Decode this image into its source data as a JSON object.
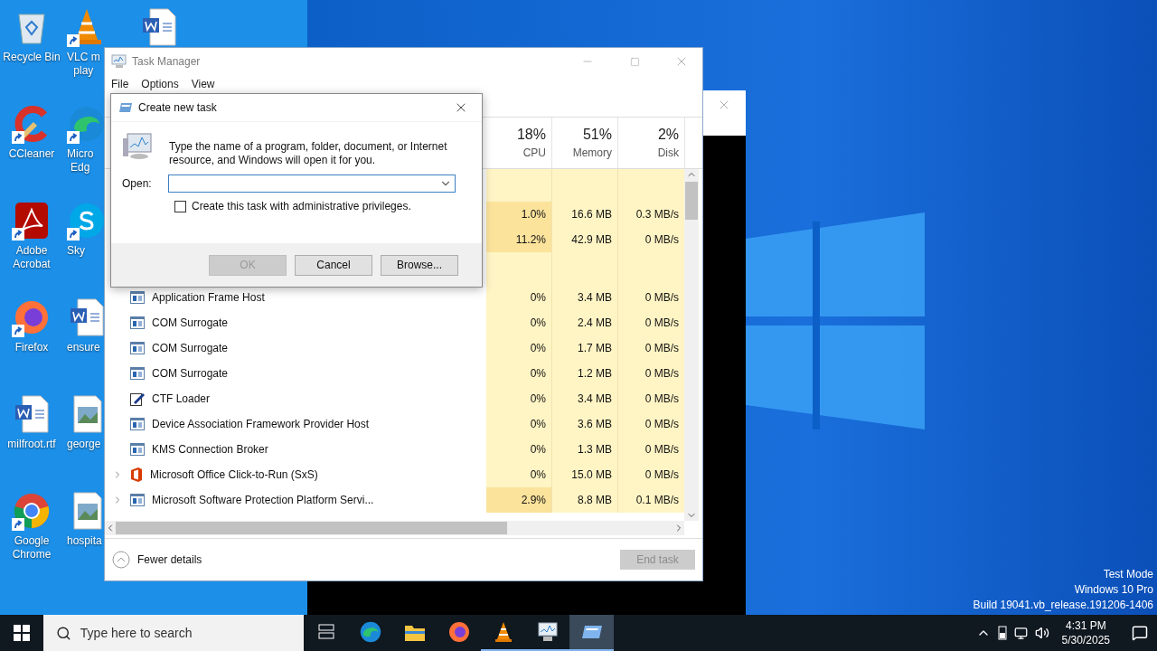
{
  "desktop_columns": [
    [
      {
        "kind": "recycle",
        "shortcut": false,
        "lines": [
          "Recycle Bin"
        ]
      },
      {
        "kind": "ccleaner",
        "shortcut": true,
        "lines": [
          "CCleaner"
        ]
      },
      {
        "kind": "acrobat",
        "shortcut": true,
        "lines": [
          "Adobe",
          "Acrobat"
        ]
      },
      {
        "kind": "firefox",
        "shortcut": true,
        "lines": [
          "Firefox"
        ]
      },
      {
        "kind": "word",
        "shortcut": false,
        "lines": [
          "milfroot.rtf"
        ]
      },
      {
        "kind": "chrome",
        "shortcut": true,
        "lines": [
          "Google",
          "Chrome"
        ]
      }
    ],
    [
      {
        "kind": "vlc",
        "shortcut": true,
        "lines": [
          "VLC m",
          "play"
        ]
      },
      {
        "kind": "edge",
        "shortcut": true,
        "lines": [
          "Micro",
          "Edg"
        ]
      },
      {
        "kind": "skype",
        "shortcut": true,
        "lines": [
          "Sky"
        ]
      },
      {
        "kind": "word",
        "shortcut": false,
        "lines": [
          "ensure"
        ]
      },
      {
        "kind": "image",
        "shortcut": false,
        "lines": [
          "george"
        ]
      },
      {
        "kind": "image",
        "shortcut": false,
        "lines": [
          "hospita"
        ]
      }
    ],
    [
      {
        "kind": "word",
        "shortcut": false
      }
    ]
  ],
  "task_manager": {
    "title": "Task Manager",
    "menu": [
      "File",
      "Options",
      "View"
    ],
    "columns": [
      {
        "percent": "18%",
        "label": "CPU"
      },
      {
        "percent": "51%",
        "label": "Memory"
      },
      {
        "percent": "2%",
        "label": "Disk"
      }
    ],
    "rows": [
      {
        "kind": "group"
      },
      {
        "kind": "covered",
        "cpu": "1.0%",
        "memory": "16.6 MB",
        "disk": "0.3 MB/s"
      },
      {
        "kind": "covered",
        "cpu": "11.2%",
        "memory": "42.9 MB",
        "disk": "0 MB/s"
      },
      {
        "kind": "group"
      },
      {
        "kind": "window",
        "expandable": false,
        "name": "Application Frame Host",
        "cpu": "0%",
        "memory": "3.4 MB",
        "disk": "0 MB/s"
      },
      {
        "kind": "window",
        "expandable": false,
        "name": "COM Surrogate",
        "cpu": "0%",
        "memory": "2.4 MB",
        "disk": "0 MB/s"
      },
      {
        "kind": "window",
        "expandable": false,
        "name": "COM Surrogate",
        "cpu": "0%",
        "memory": "1.7 MB",
        "disk": "0 MB/s"
      },
      {
        "kind": "window",
        "expandable": false,
        "name": "COM Surrogate",
        "cpu": "0%",
        "memory": "1.2 MB",
        "disk": "0 MB/s"
      },
      {
        "kind": "pen",
        "expandable": false,
        "name": "CTF Loader",
        "cpu": "0%",
        "memory": "3.4 MB",
        "disk": "0 MB/s"
      },
      {
        "kind": "window",
        "expandable": false,
        "name": "Device Association Framework Provider Host",
        "cpu": "0%",
        "memory": "3.6 MB",
        "disk": "0 MB/s"
      },
      {
        "kind": "window",
        "expandable": false,
        "name": "KMS Connection Broker",
        "cpu": "0%",
        "memory": "1.3 MB",
        "disk": "0 MB/s"
      },
      {
        "kind": "office",
        "expandable": true,
        "name": "Microsoft Office Click-to-Run (SxS)",
        "cpu": "0%",
        "memory": "15.0 MB",
        "disk": "0 MB/s"
      },
      {
        "kind": "window",
        "expandable": true,
        "name": "Microsoft Software Protection Platform Servi...",
        "cpu": "2.9%",
        "memory": "8.8 MB",
        "disk": "0.1 MB/s"
      }
    ],
    "fewer_details": "Fewer details",
    "end_task": {
      "label": "End task",
      "disabled": true
    }
  },
  "dialog": {
    "title": "Create new task",
    "message": "Type the name of a program, folder, document, or Internet resource, and Windows will open it for you.",
    "open_label": "Open:",
    "checkbox": {
      "label": "Create this task with administrative privileges.",
      "checked": false
    },
    "buttons": [
      {
        "label": "OK",
        "disabled": true
      },
      {
        "label": "Cancel",
        "disabled": false
      },
      {
        "label": "Browse...",
        "disabled": false
      }
    ]
  },
  "os_info": [
    "Test Mode",
    "Windows 10 Pro",
    "Build 19041.vb_release.191206-1406"
  ],
  "taskbar": {
    "search_placeholder": "Type here to search",
    "apps": [
      {
        "kind": "taskview",
        "running": false,
        "selected": false
      },
      {
        "kind": "edge",
        "running": false,
        "selected": false
      },
      {
        "kind": "explorer",
        "running": false,
        "selected": false
      },
      {
        "kind": "firefox",
        "running": false,
        "selected": false
      },
      {
        "kind": "vlc",
        "running": true,
        "selected": false
      },
      {
        "kind": "taskmgr",
        "running": true,
        "selected": false
      },
      {
        "kind": "runapp",
        "running": true,
        "selected": true
      }
    ],
    "time": "4:31 PM",
    "date": "5/30/2025"
  }
}
